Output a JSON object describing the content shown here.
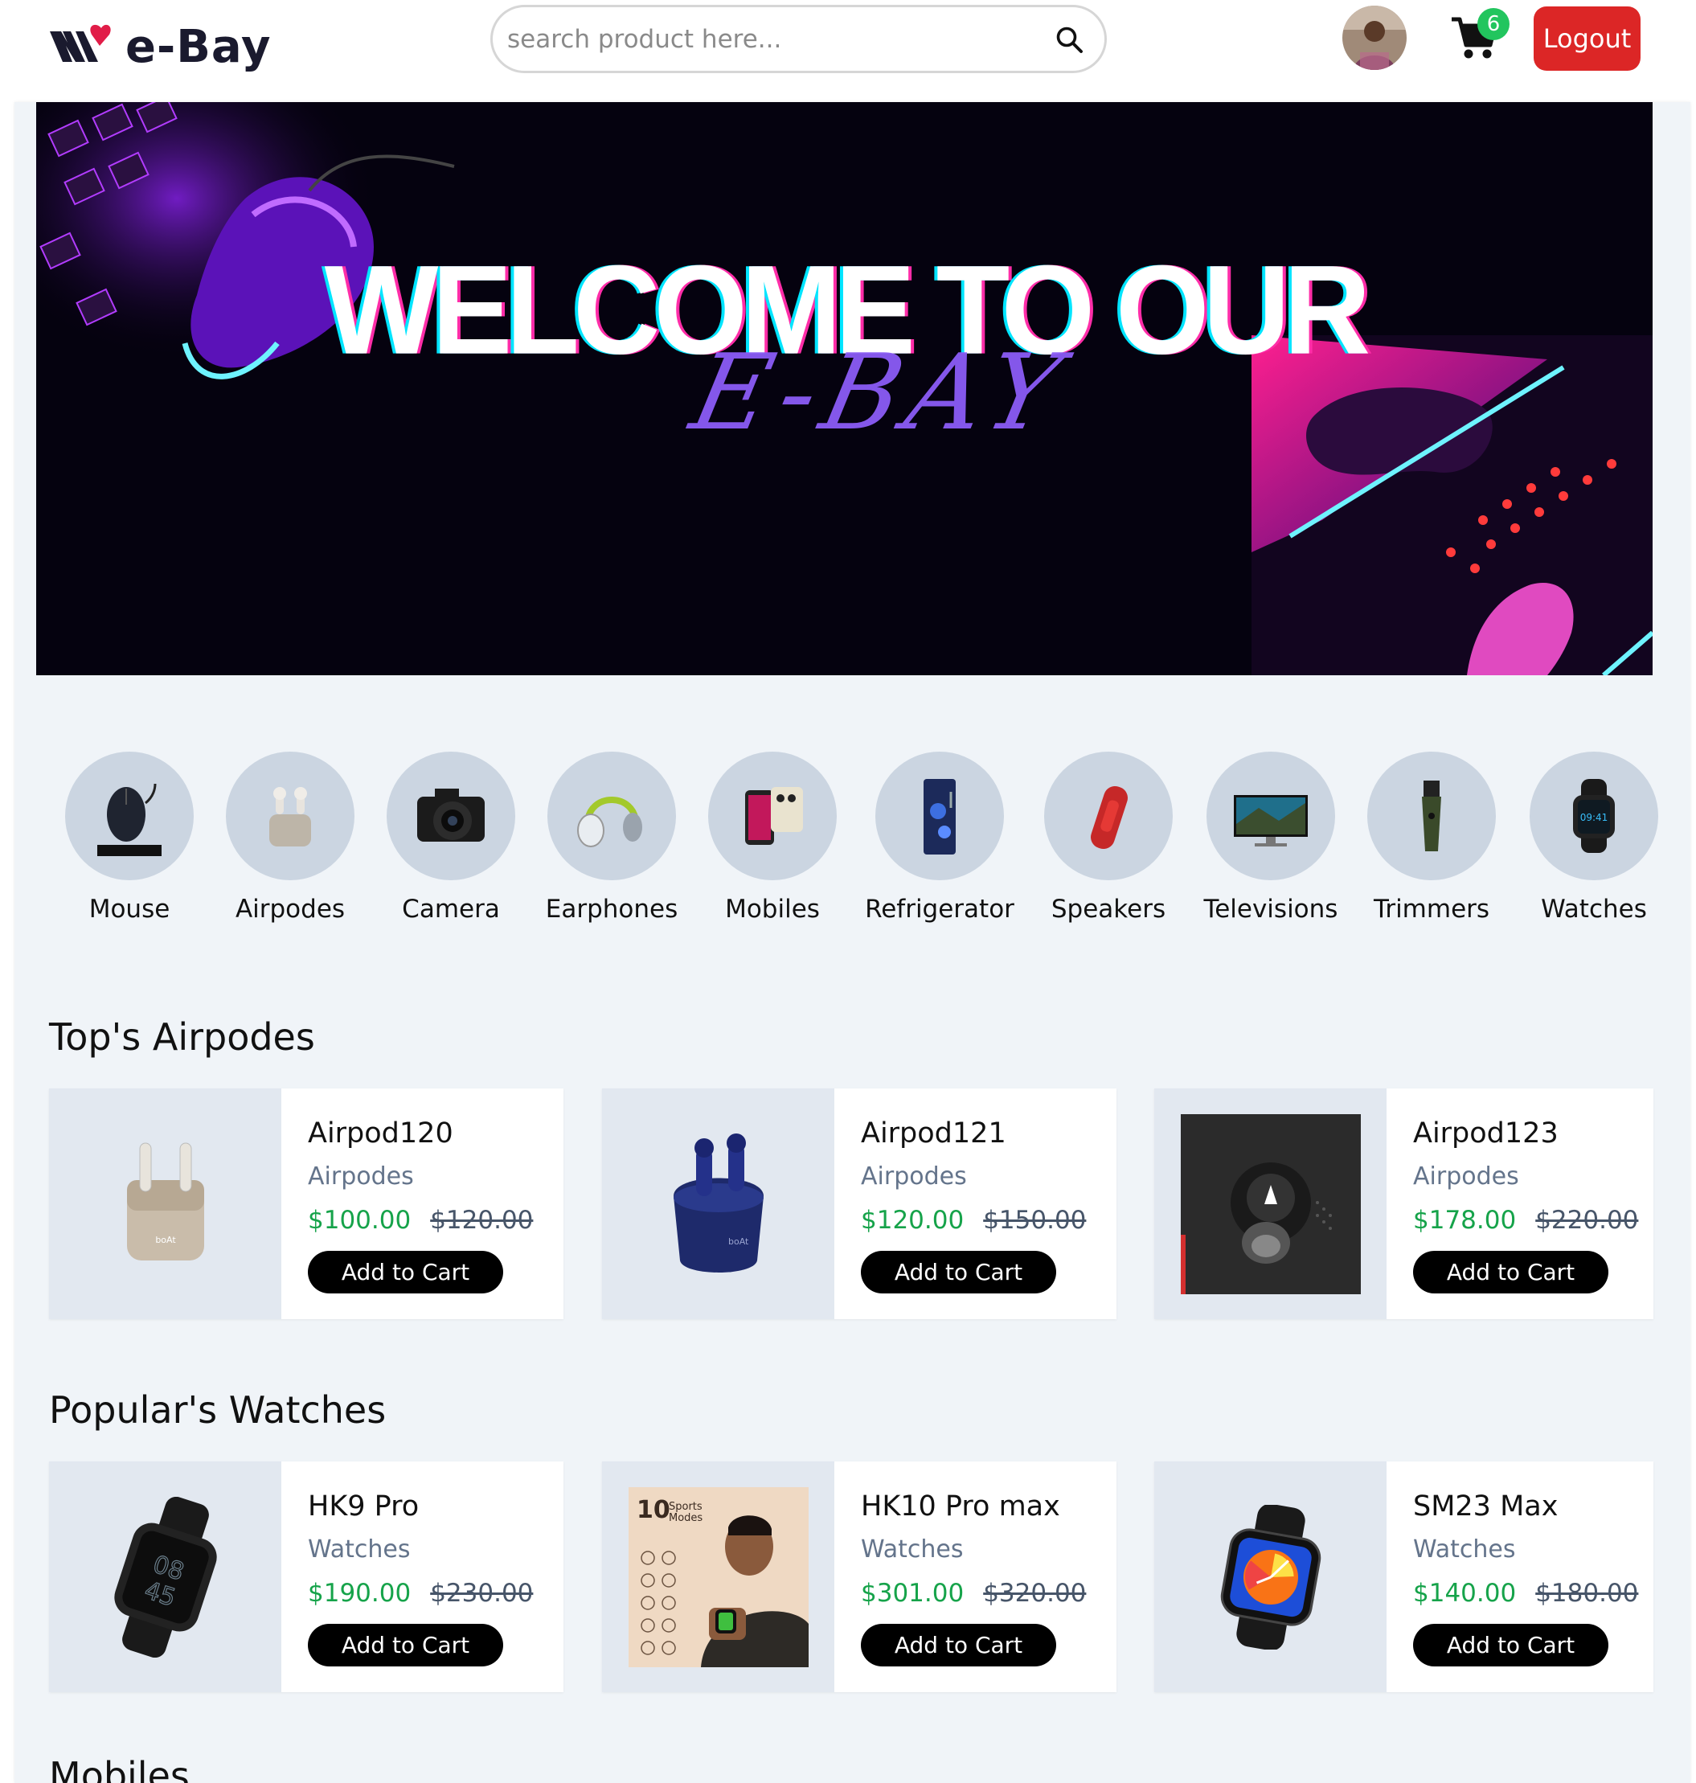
{
  "header": {
    "logo_text": "e-Bay",
    "search_placeholder": "search product here...",
    "cart_count": "6",
    "logout_label": "Logout"
  },
  "banner": {
    "title": "WELCOME TO OUR",
    "subtitle": "E-BAY"
  },
  "categories": [
    {
      "label": "Mouse",
      "icon": "mouse-icon"
    },
    {
      "label": "Airpodes",
      "icon": "airpods-icon"
    },
    {
      "label": "Camera",
      "icon": "camera-icon"
    },
    {
      "label": "Earphones",
      "icon": "headphones-icon"
    },
    {
      "label": "Mobiles",
      "icon": "mobile-icon"
    },
    {
      "label": "Refrigerator",
      "icon": "refrigerator-icon"
    },
    {
      "label": "Speakers",
      "icon": "speaker-icon"
    },
    {
      "label": "Televisions",
      "icon": "television-icon"
    },
    {
      "label": "Trimmers",
      "icon": "trimmer-icon"
    },
    {
      "label": "Watches",
      "icon": "watch-icon"
    }
  ],
  "sections": [
    {
      "title": "Top's Airpodes",
      "products": [
        {
          "name": "Airpod120",
          "category": "Airpodes",
          "price": "$100.00",
          "old_price": "$120.00",
          "button": "Add to Cart"
        },
        {
          "name": "Airpod121",
          "category": "Airpodes",
          "price": "$120.00",
          "old_price": "$150.00",
          "button": "Add to Cart"
        },
        {
          "name": "Airpod123",
          "category": "Airpodes",
          "price": "$178.00",
          "old_price": "$220.00",
          "button": "Add to Cart"
        }
      ]
    },
    {
      "title": "Popular's Watches",
      "products": [
        {
          "name": "HK9 Pro",
          "category": "Watches",
          "price": "$190.00",
          "old_price": "$230.00",
          "button": "Add to Cart"
        },
        {
          "name": "HK10 Pro max",
          "category": "Watches",
          "price": "$301.00",
          "old_price": "$320.00",
          "button": "Add to Cart"
        },
        {
          "name": "SM23 Max",
          "category": "Watches",
          "price": "$140.00",
          "old_price": "$180.00",
          "button": "Add to Cart"
        }
      ]
    }
  ],
  "next_section_title": "Mobiles",
  "colors": {
    "logout": "#dc2626",
    "badge": "#22c55e",
    "price": "#16a34a",
    "page_bg": "#f0f4f8",
    "category_circle": "#cbd5e1"
  }
}
